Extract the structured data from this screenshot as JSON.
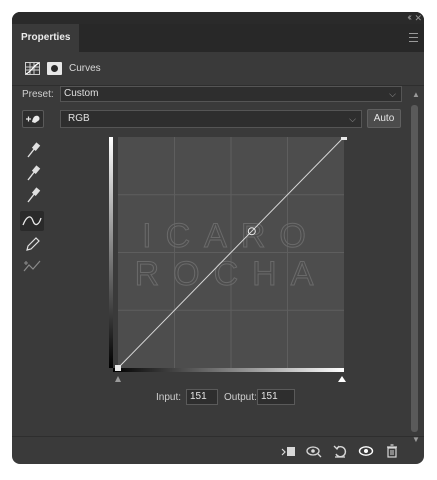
{
  "panel": {
    "tab_label": "Properties",
    "adjustment_title": "Curves"
  },
  "preset": {
    "label": "Preset:",
    "value": "Custom"
  },
  "channel": {
    "value": "RGB",
    "auto_label": "Auto"
  },
  "curve": {
    "points": [
      [
        0,
        0
      ],
      [
        151,
        151
      ],
      [
        255,
        255
      ]
    ],
    "range": [
      0,
      255
    ],
    "watermark_lines": [
      "ICARO",
      "ROCHA"
    ]
  },
  "readout": {
    "input_label": "Input:",
    "input_value": "151",
    "output_label": "Output:",
    "output_value": "151"
  },
  "icons": {
    "tools": [
      "target-adjust-icon",
      "black-point-eyedropper-icon",
      "gray-point-eyedropper-icon",
      "white-point-eyedropper-icon",
      "curve-points-icon",
      "pencil-icon",
      "smooth-icon"
    ],
    "footer": [
      "clip-to-layer-icon",
      "view-previous-icon",
      "reset-icon",
      "visibility-icon",
      "delete-icon"
    ]
  }
}
